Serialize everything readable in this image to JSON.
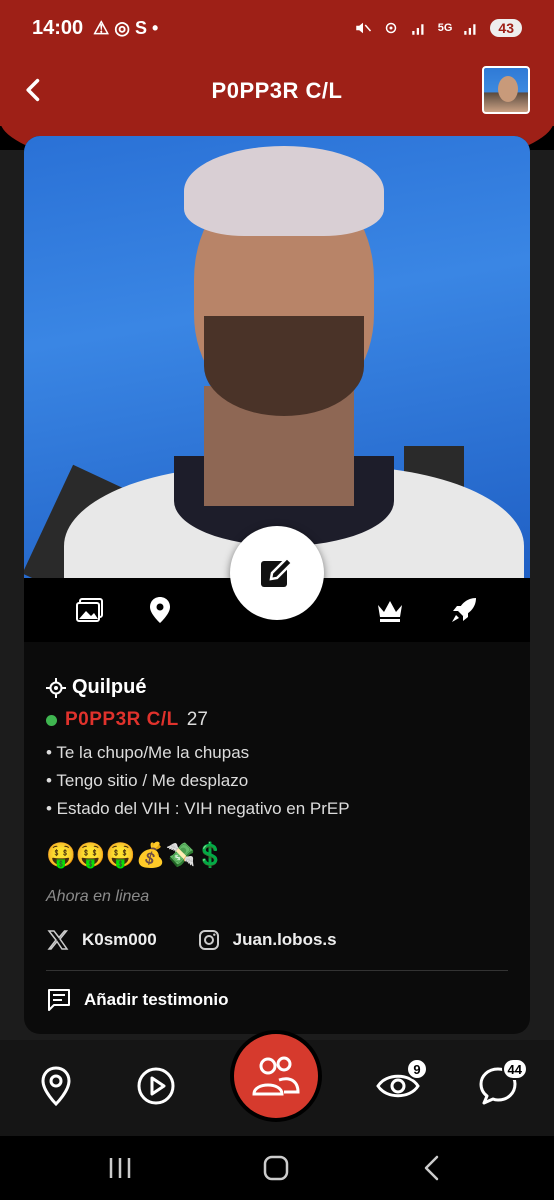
{
  "status_bar": {
    "time": "14:00",
    "left_glyphs": "⚠ ◎ S •",
    "network": "5G",
    "battery": "43"
  },
  "header": {
    "title": "P0PP3R C/L"
  },
  "profile": {
    "city": "Quilpué",
    "name": "P0PP3R C/L",
    "age": "27",
    "bullets": [
      "• Te la chupo/Me la chupas",
      "• Tengo sitio / Me desplazo",
      "• Estado del VIH : VIH negativo en PrEP"
    ],
    "emojis": "🤑🤑🤑💰💸💲",
    "last_seen": "Ahora en linea",
    "twitter": "K0sm000",
    "instagram": "Juan.lobos.s",
    "add_testimonial": "Añadir testimonio"
  },
  "bottom_nav": {
    "views_badge": "9",
    "messages_badge": "44"
  },
  "colors": {
    "brand_red": "#9e2017",
    "accent_red": "#d63a2d",
    "name_red": "#e0322c",
    "online_green": "#3fb650"
  }
}
